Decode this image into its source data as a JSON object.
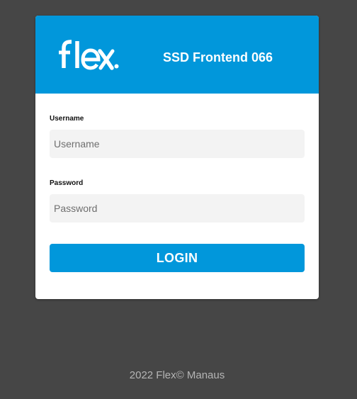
{
  "header": {
    "logo_text": "flex.",
    "app_title": "SSD Frontend 066"
  },
  "form": {
    "username_label": "Username",
    "username_placeholder": "Username",
    "username_value": "",
    "password_label": "Password",
    "password_placeholder": "Password",
    "password_value": "",
    "login_label": "LOGIN"
  },
  "footer": {
    "text": "2022 Flex© Manaus"
  },
  "colors": {
    "background": "#464646",
    "brand_blue": "#0197db",
    "input_bg": "#f3f3f3",
    "card_bg": "#ffffff"
  },
  "icons": {
    "logo": "flex-logo"
  }
}
